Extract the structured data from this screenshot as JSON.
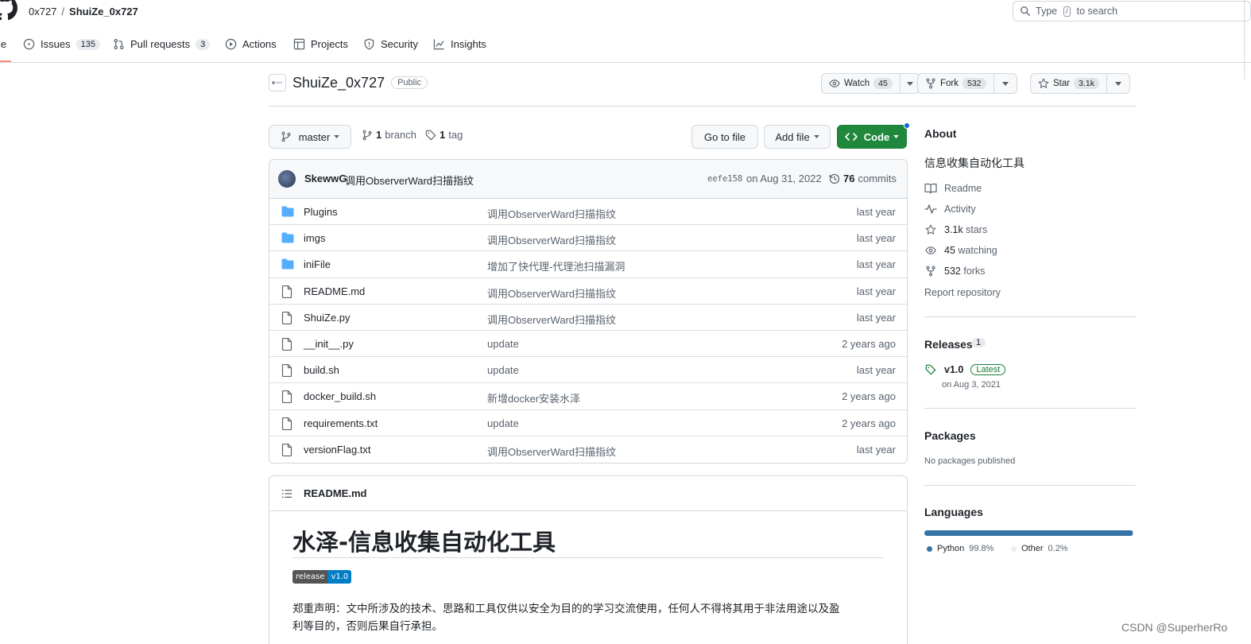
{
  "header": {
    "owner": "0x727",
    "separator": "/",
    "repo": "ShuiZe_0x727",
    "search_prefix": "Type",
    "search_key": "/",
    "search_suffix": "to search"
  },
  "nav": {
    "code_partial": "le",
    "issues": {
      "label": "Issues",
      "count": "135"
    },
    "pulls": {
      "label": "Pull requests",
      "count": "3"
    },
    "actions": "Actions",
    "projects": "Projects",
    "security": "Security",
    "insights": "Insights"
  },
  "repo": {
    "name": "ShuiZe_0x727",
    "visibility": "Public",
    "watch": {
      "label": "Watch",
      "count": "45"
    },
    "fork": {
      "label": "Fork",
      "count": "532"
    },
    "star": {
      "label": "Star",
      "count": "3.1k"
    }
  },
  "toolbar": {
    "branch": "master",
    "branches_count": "1",
    "branches_label": "branch",
    "tags_count": "1",
    "tags_label": "tag",
    "go_to_file": "Go to file",
    "add_file": "Add file",
    "code": "Code"
  },
  "commit": {
    "author": "SkewwG",
    "message": "调用ObserverWard扫描指纹",
    "sha": "eefe158",
    "date": "on Aug 31, 2022",
    "count": "76",
    "count_label": "commits"
  },
  "files": [
    {
      "type": "dir",
      "name": "Plugins",
      "message": "调用ObserverWard扫描指纹",
      "age": "last year"
    },
    {
      "type": "dir",
      "name": "imgs",
      "message": "调用ObserverWard扫描指纹",
      "age": "last year"
    },
    {
      "type": "dir",
      "name": "iniFile",
      "message": "增加了快代理-代理池扫描漏洞",
      "age": "last year"
    },
    {
      "type": "file",
      "name": "README.md",
      "message": "调用ObserverWard扫描指纹",
      "age": "last year"
    },
    {
      "type": "file",
      "name": "ShuiZe.py",
      "message": "调用ObserverWard扫描指纹",
      "age": "last year"
    },
    {
      "type": "file",
      "name": "__init__.py",
      "message": "update",
      "age": "2 years ago"
    },
    {
      "type": "file",
      "name": "build.sh",
      "message": "update",
      "age": "last year"
    },
    {
      "type": "file",
      "name": "docker_build.sh",
      "message": "新增docker安装水泽",
      "age": "2 years ago"
    },
    {
      "type": "file",
      "name": "requirements.txt",
      "message": "update",
      "age": "2 years ago"
    },
    {
      "type": "file",
      "name": "versionFlag.txt",
      "message": "调用ObserverWard扫描指纹",
      "age": "last year"
    }
  ],
  "readme": {
    "filename": "README.md",
    "title": "水泽-信息收集自动化工具",
    "badge_left": "release",
    "badge_right": "v1.0",
    "disclaimer_line1": "郑重声明：文中所涉及的技术、思路和工具仅供以安全为目的的学习交流使用，任何人不得将其用于非法用途以及盈",
    "disclaimer_line2": "利等目的，否则后果自行承担。"
  },
  "about": {
    "heading": "About",
    "description": "信息收集自动化工具",
    "readme": "Readme",
    "activity": "Activity",
    "stars_count": "3.1k",
    "stars_label": "stars",
    "watching_count": "45",
    "watching_label": "watching",
    "forks_count": "532",
    "forks_label": "forks",
    "report": "Report repository"
  },
  "releases": {
    "heading": "Releases",
    "count": "1",
    "tag": "v1.0",
    "latest_label": "Latest",
    "date": "on Aug 3, 2021"
  },
  "packages": {
    "heading": "Packages",
    "empty": "No packages published"
  },
  "languages": {
    "heading": "Languages",
    "items": [
      {
        "name": "Python",
        "percent": "99.8%",
        "share": 0.998,
        "color": "#3572a5"
      },
      {
        "name": "Other",
        "percent": "0.2%",
        "share": 0.002,
        "color": "#ededed"
      }
    ]
  },
  "watermark": "CSDN @SuperherRo",
  "colors": {
    "accent_green": "#1f883d",
    "link_blue": "#0969da",
    "folder_blue": "#54aeff"
  }
}
